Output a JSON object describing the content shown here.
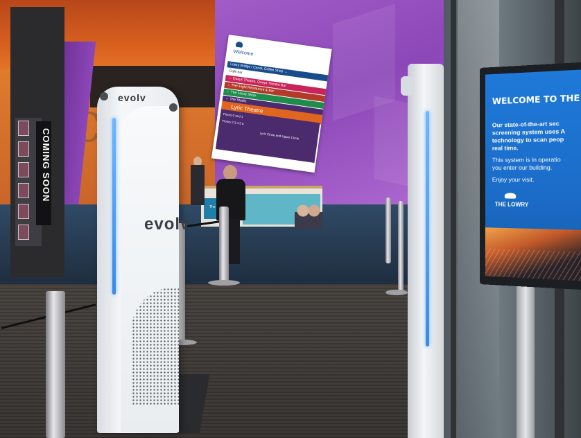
{
  "scene": {
    "description_colors": {
      "orange_wall": "#d8601f",
      "purple_wall": "#8c47b8",
      "screen_blue": "#1b6cc8",
      "scanner_white": "#f5f7f9",
      "scanner_light": "#6fb7ff"
    }
  },
  "brochure_stand": {
    "text": "COMING SOON"
  },
  "scanner": {
    "brand_top": "evolv",
    "brand_mid": "evolv"
  },
  "wayfinding_sign": {
    "title": "Welcome",
    "rows": [
      "Lowry Bridge / Canal, Coffee Shop →",
      "Café bar",
      "← Quays Theatre, Quays Theatre Bar",
      "← Pier Eight Restaurant & Bar",
      "← The Lowry Shop",
      "← The Studio"
    ],
    "highlight": "Lyric Theatre",
    "lower_lines": [
      "Floors 0 and 1",
      "Floors 2 3 4 5 6",
      "Lyric Circle and Upper Circle"
    ]
  },
  "reception_desk": {
    "logo_text": "The Lowry"
  },
  "digital_screen": {
    "title": "WELCOME TO THE LO",
    "lines": [
      "Our state-of-the-art sec",
      "screening system uses A",
      "technology to scan peop",
      "real time."
    ],
    "line2": [
      "This system is in operatio",
      "you enter our building."
    ],
    "line3": "Enjoy your visit.",
    "logo": "THE LOWRY"
  }
}
